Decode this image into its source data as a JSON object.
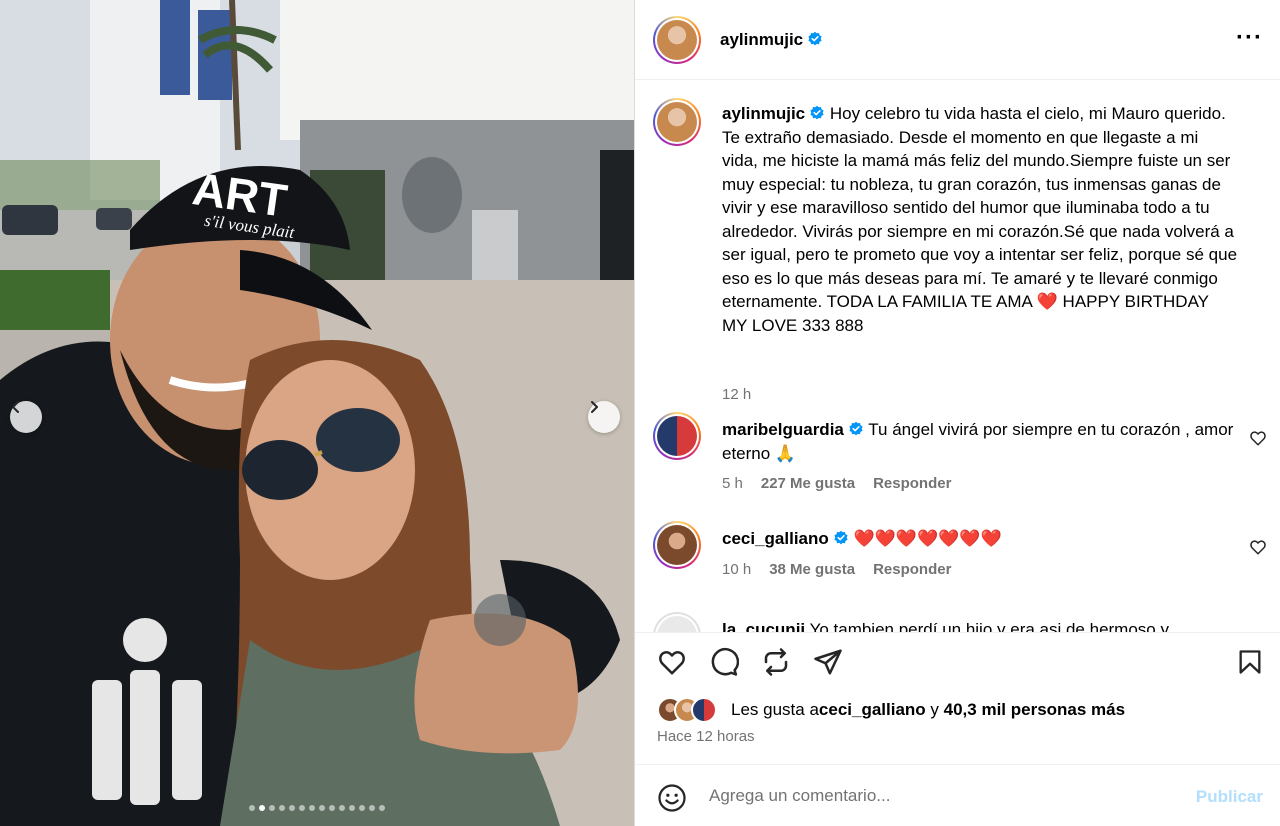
{
  "post": {
    "author": "aylinmujic",
    "author_verified": true,
    "caption": "Hoy celebro tu vida hasta el cielo, mi Mauro querido. Te extraño demasiado. Desde el momento en que llegaste a mi vida, me hiciste la mamá más feliz del mundo.Siempre fuiste un ser muy especial: tu nobleza, tu gran corazón, tus inmensas ganas de vivir y ese maravilloso sentido del humor que iluminaba todo a tu alrededor. Vivirás por siempre en mi corazón.Sé que nada volverá a ser igual, pero te prometo que voy a intentar ser feliz, porque sé que eso es lo que más deseas para mí. Te amaré y te llevaré conmigo eternamente. TODA LA FAMILIA TE AMA ❤️ HAPPY BIRTHDAY MY LOVE 333 888",
    "caption_time": "12 h",
    "more_icon": "more-options-icon",
    "photo_text": {
      "cap_front": "ART",
      "cap_script": "s'il vous plait"
    },
    "carousel": {
      "total_slides": 14,
      "active_index": 1
    }
  },
  "comments": [
    {
      "user": "maribelguardia",
      "verified": true,
      "text": "Tu ángel vivirá por siempre en tu corazón , amor eterno 🙏",
      "time": "5 h",
      "likes": "227 Me gusta",
      "reply": "Responder"
    },
    {
      "user": "ceci_galliano",
      "verified": true,
      "text": "❤️❤️❤️❤️❤️❤️❤️",
      "time": "10 h",
      "likes": "38 Me gusta",
      "reply": "Responder"
    },
    {
      "user": "la_cucunii",
      "verified": false,
      "text": "Yo tambien perdí un hijo y era asi de hermoso y"
    }
  ],
  "actions": {
    "like_icon": "heart-icon",
    "comment_icon": "comment-icon",
    "repost_icon": "repost-icon",
    "share_icon": "share-icon",
    "save_icon": "bookmark-icon"
  },
  "likes_summary": {
    "prefix": "Les gusta a ",
    "user": "ceci_galliano",
    "middle": " y ",
    "others": "40,3 mil personas más"
  },
  "posted_ago": "Hace 12 horas",
  "comment_box": {
    "placeholder": "Agrega un comentario...",
    "publish_label": "Publicar",
    "emoji_icon": "emoji-icon"
  },
  "colors": {
    "verified": "#0095f6",
    "publish_disabled": "#b2dffc",
    "meta": "#737373"
  }
}
